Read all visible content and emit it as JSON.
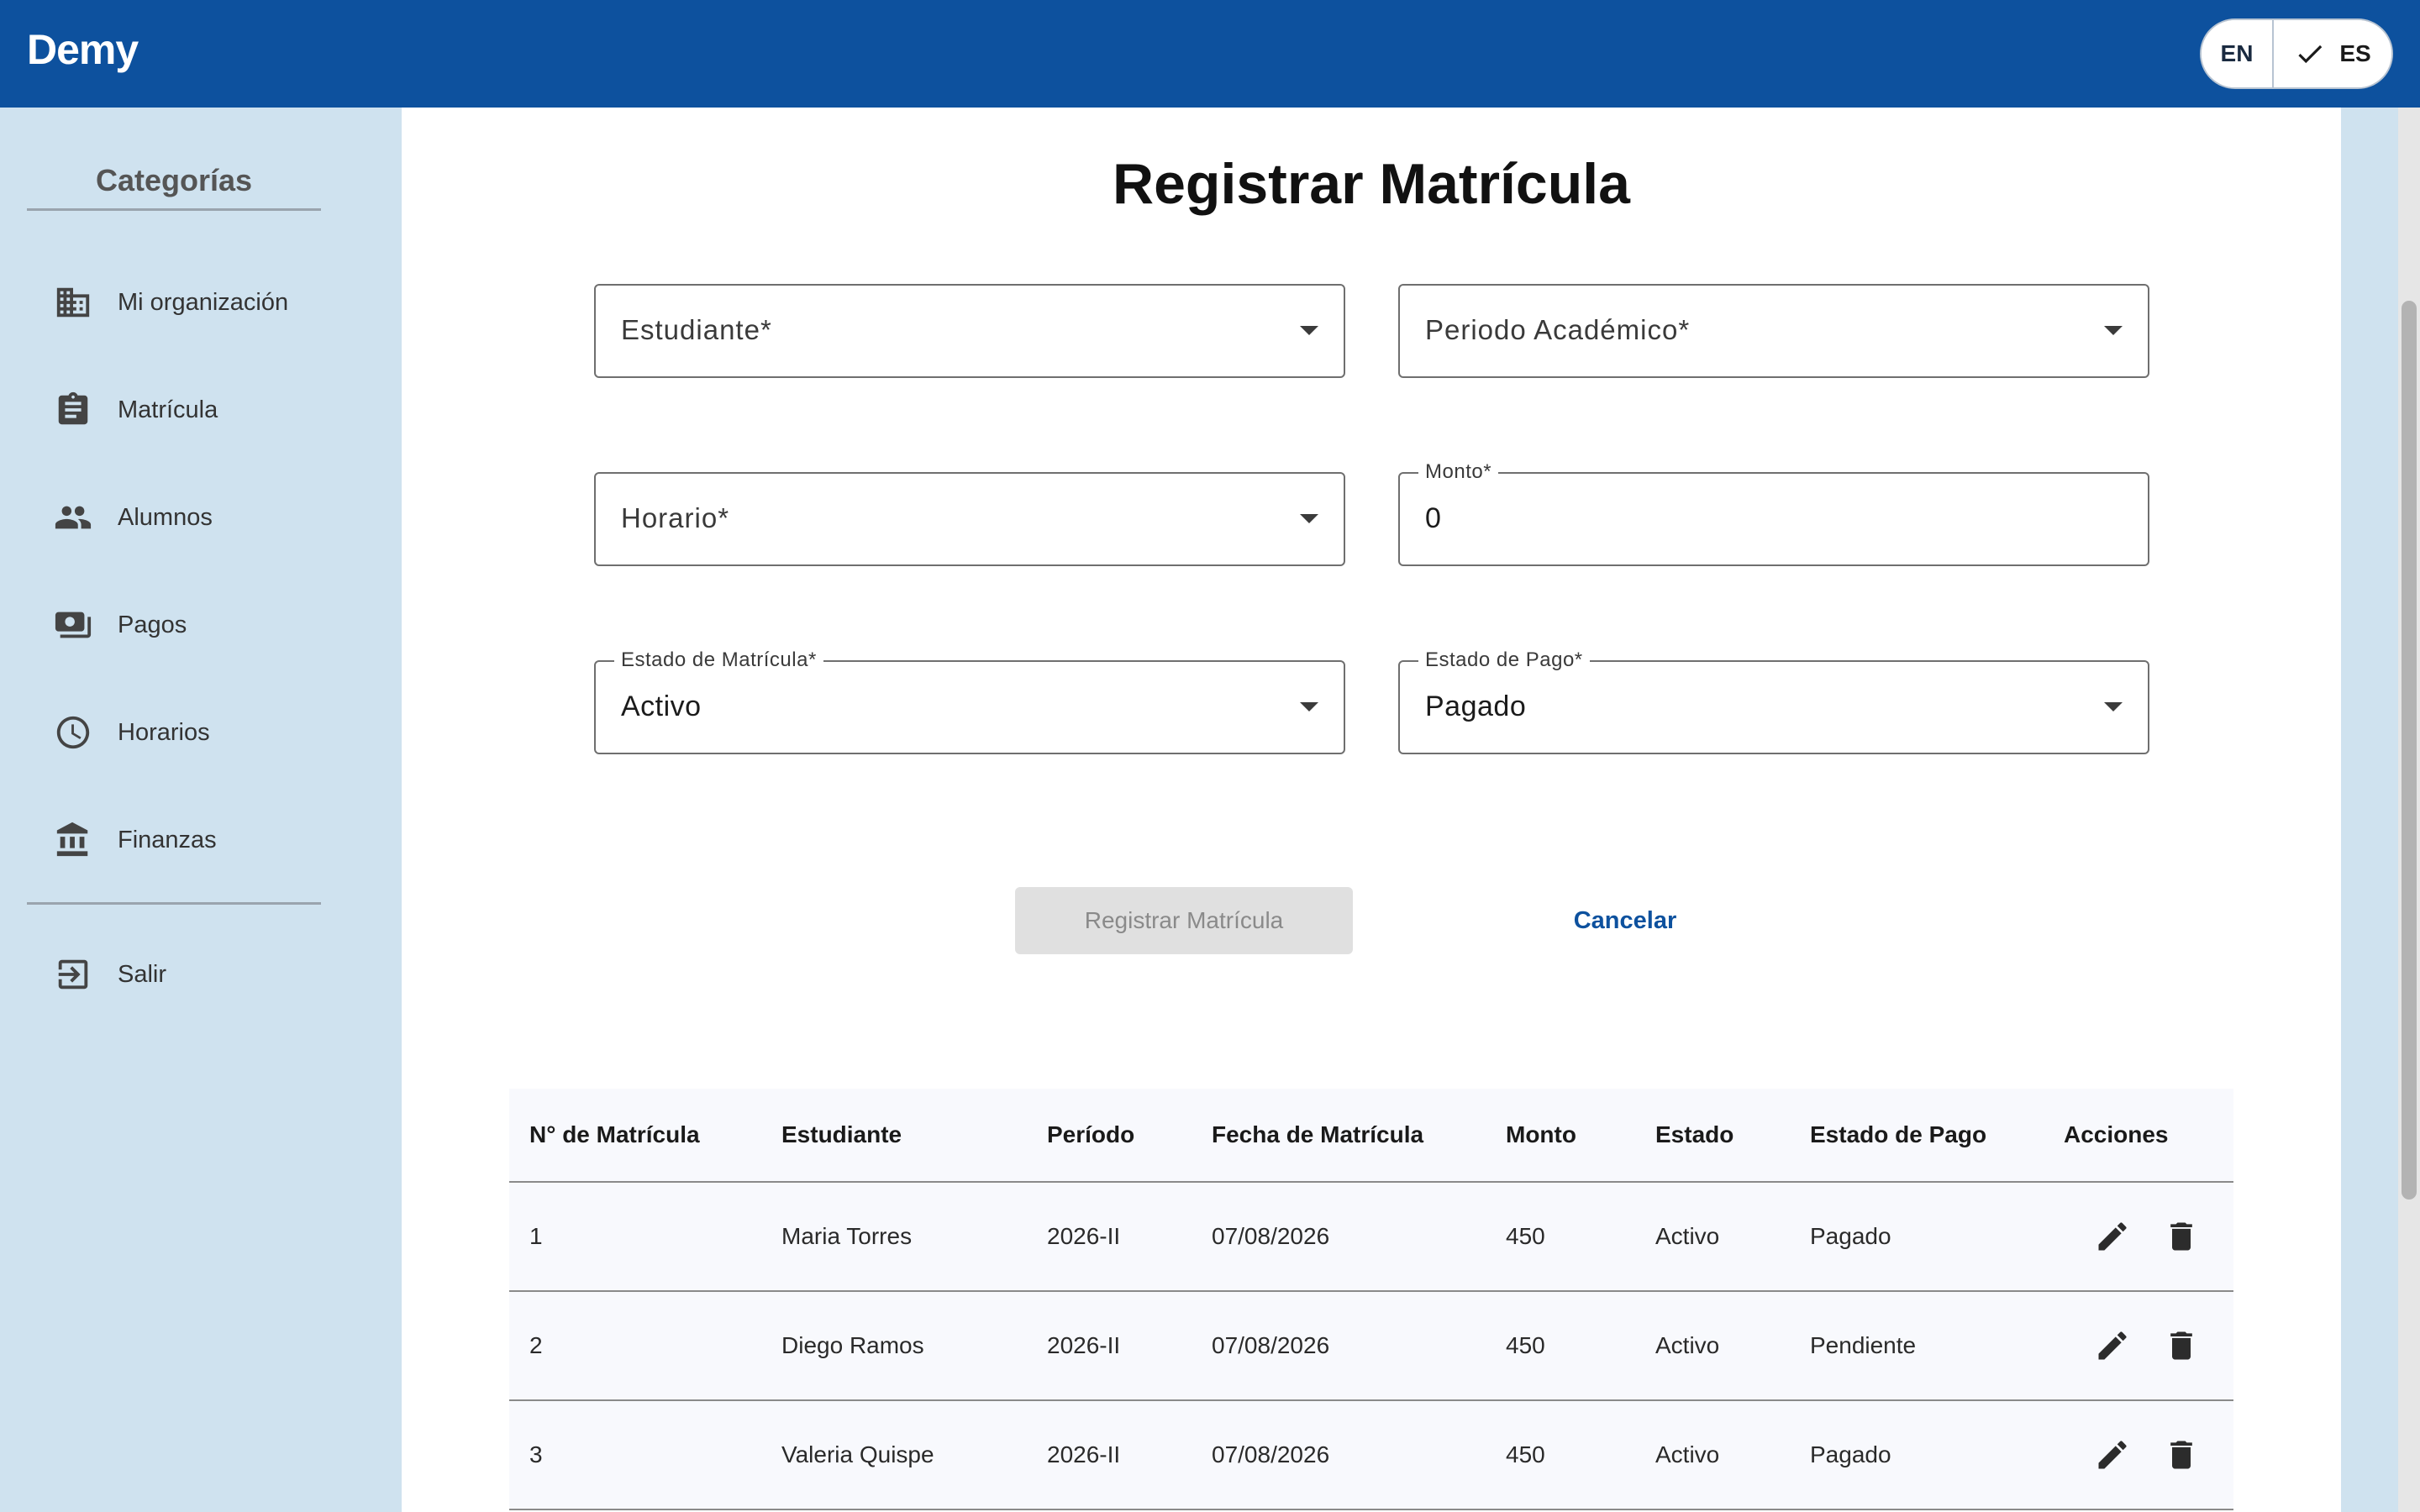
{
  "header": {
    "brand": "Demy",
    "lang_en": "EN",
    "lang_es": "ES",
    "brand_color": "#0d519e"
  },
  "sidebar": {
    "title": "Categorías",
    "items": [
      {
        "label": "Mi organización",
        "icon": "building-icon"
      },
      {
        "label": "Matrícula",
        "icon": "clipboard-icon"
      },
      {
        "label": "Alumnos",
        "icon": "people-icon"
      },
      {
        "label": "Pagos",
        "icon": "payments-icon"
      },
      {
        "label": "Horarios",
        "icon": "clock-icon"
      },
      {
        "label": "Finanzas",
        "icon": "bank-icon"
      }
    ],
    "logout": {
      "label": "Salir",
      "icon": "logout-icon"
    }
  },
  "form": {
    "title": "Registrar Matrícula",
    "estudiante": {
      "placeholder": "Estudiante*"
    },
    "periodo": {
      "placeholder": "Periodo Académico*"
    },
    "horario": {
      "placeholder": "Horario*"
    },
    "monto": {
      "label": "Monto*",
      "value": "0"
    },
    "estado_matricula": {
      "label": "Estado de Matrícula*",
      "value": "Activo"
    },
    "estado_pago": {
      "label": "Estado de Pago*",
      "value": "Pagado"
    },
    "submit_label": "Registrar Matrícula",
    "cancel_label": "Cancelar"
  },
  "table": {
    "columns": [
      "N° de Matrícula",
      "Estudiante",
      "Período",
      "Fecha de Matrícula",
      "Monto",
      "Estado",
      "Estado de Pago",
      "Acciones"
    ],
    "rows": [
      [
        "1",
        "Maria Torres",
        "2026-II",
        "07/08/2026",
        "450",
        "Activo",
        "Pagado"
      ],
      [
        "2",
        "Diego Ramos",
        "2026-II",
        "07/08/2026",
        "450",
        "Activo",
        "Pendiente"
      ],
      [
        "3",
        "Valeria Quispe",
        "2026-II",
        "07/08/2026",
        "450",
        "Activo",
        "Pagado"
      ]
    ]
  }
}
